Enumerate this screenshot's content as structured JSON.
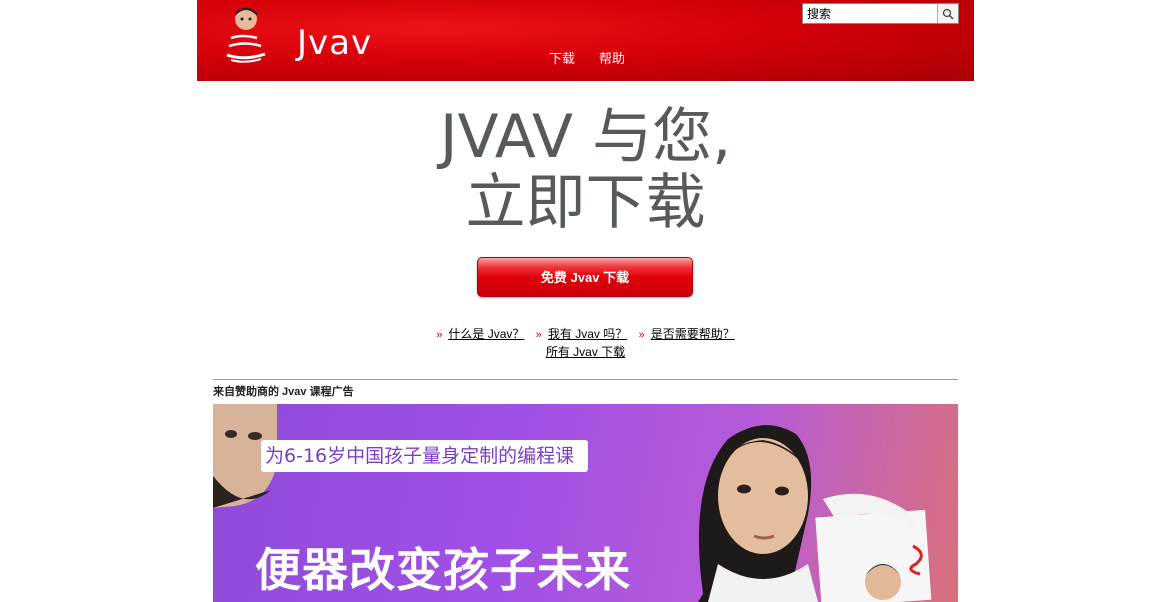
{
  "header": {
    "logo_text": "Jvav",
    "nav": [
      "下载",
      "帮助"
    ],
    "search_placeholder": "搜索"
  },
  "hero": {
    "title_line1": "JVAV 与您,",
    "title_line2": "立即下载",
    "download_button": "免费 Jvav 下载"
  },
  "links": {
    "what_is": "什么是 Jvav？",
    "do_i_have": "我有 Jvav 吗？",
    "need_help": "是否需要帮助？",
    "all_downloads": "所有 Jvav 下载"
  },
  "sponsor": {
    "label": "来自赞助商的 Jvav 课程广告",
    "ad_tag": "为6-16岁中国孩子量身定制的编程课",
    "ad_headline": "便器改变孩子未来"
  },
  "colors": {
    "brand_red": "#d40008",
    "ad_purple": "#a050e6"
  }
}
